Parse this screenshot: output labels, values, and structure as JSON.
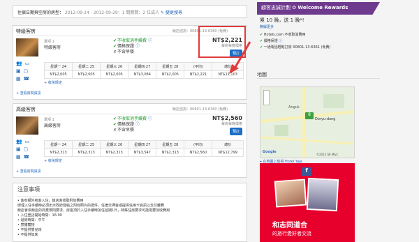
{
  "search_bar": {
    "label": "住宿日期與空房的房型：",
    "dates": "2012-09-24 - 2012-09-29：1 間開間：2 位成人",
    "change_link": "變更搜尋"
  },
  "rooms": [
    {
      "name_header": "特級客房",
      "phone": "飯店諮詢：00801-13-6360 (免費)",
      "room_type_small": "選項 1",
      "room_type": "特級客房",
      "features": [
        "不收取消手續費",
        "價格保證",
        "不含早餐"
      ],
      "price": "NT$2,221",
      "price_note": "每房每晚價格",
      "book_label": "預訂",
      "days": [
        "星期一 24",
        "星期二 25",
        "星期三 26",
        "星期四 27",
        "星期五 28",
        "(平均)",
        "總計"
      ],
      "prices": [
        "NT$2,005",
        "NT$2,005",
        "NT$2,005",
        "NT$3,084",
        "NT$2,005",
        "NT$2,221",
        "NT$11,103"
      ],
      "tax_link": "收稅規定",
      "more_link": "查看房間資訊"
    },
    {
      "name_header": "高級客房",
      "phone": "飯店諮詢：00801-13-6360 (免費)",
      "room_type_small": "選項 1",
      "room_type": "高級客房",
      "features": [
        "不收取消手續費",
        "價格保證",
        "不含早餐"
      ],
      "price": "NT$2,560",
      "price_note": "每房每晚價格",
      "book_label": "預訂",
      "days": [
        "星期一 24",
        "星期二 25",
        "星期三 26",
        "星期四 27",
        "星期五 28",
        "(平均)",
        "總計"
      ],
      "prices": [
        "NT$2,313",
        "NT$2,313",
        "NT$2,313",
        "NT$3,547",
        "NT$2,313",
        "NT$2,560",
        "NT$12,799"
      ],
      "tax_link": "收稅規定",
      "more_link": "查看房間資訊"
    }
  ],
  "notes": {
    "title": "注意事項",
    "lines": [
      "• 客有額外房客入住，飯店會收取附加費用",
      "  辦理入住手續時必須出示政府發給之附有照片的證件，住宿交押金或提供信用卡資訊以支付雜費",
      "  飯店會依飯店的商業規則要求，房客須於入住手續時加住延期1日，特殊住房要求可能需要加收費用",
      "• 入住登記開始時間：16:00",
      "• 退房時間：中午",
      "• 禁攜寵物",
      "• 不提供嬰兒床",
      "• 不提供加床"
    ]
  },
  "rewards": {
    "banner_label": "顧客忠誠計劃",
    "banner_brand": "Welcome Rewards",
    "stay_line": "累 10 晚，送 1 晚*!",
    "learn_more": "瞭解更多",
    "benefits": [
      "Hotels.com 不收取消費用",
      "價格保證",
      "一通電話輕鬆訂房 00801-13-6361 (免費)"
    ]
  },
  "map": {
    "title": "地圖",
    "label": "Anguk",
    "district": "Doryu-dong",
    "google_label": "Google",
    "copyright": "©2012 SK M&C",
    "view_link": "在地圖上檢視 Hotel Yaja"
  },
  "ad": {
    "tagline": "和志同道合",
    "subtitle": "的旅行愛好者交流"
  }
}
